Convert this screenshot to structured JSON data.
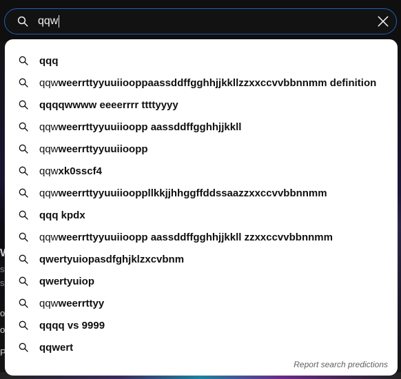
{
  "search": {
    "value": "qqw",
    "icon": "search-icon",
    "clear_icon": "close-icon",
    "accent_color": "#1c62b9"
  },
  "suggestions": [
    {
      "prefix": "",
      "rest": "qqq"
    },
    {
      "prefix": "qqw",
      "rest": "weerrttyyuuiiooppaassddffgghhjjkkllzzxxccvvbbnnmm definition"
    },
    {
      "prefix": "",
      "rest": "qqqqwwww eeeerrrr ttttyyyy"
    },
    {
      "prefix": "qqw",
      "rest": "weerrttyyuuiioopp aassddffgghhjjkkll"
    },
    {
      "prefix": "qqw",
      "rest": "weerrttyyuuiioopp"
    },
    {
      "prefix": "qqw",
      "rest": "xk0sscf4"
    },
    {
      "prefix": "qqw",
      "rest": "weerrttyyuuiiooppllkkjjhhggffddssaazzxxccvvbbnnmm"
    },
    {
      "prefix": "",
      "rest": "qqq kpdx"
    },
    {
      "prefix": "qqw",
      "rest": "weerrttyyuuiioopp aassddffgghhjjkkll zzxxccvvbbnnmm"
    },
    {
      "prefix": "",
      "rest": "qwertyuiopasdfghjklzxcvbnm"
    },
    {
      "prefix": "",
      "rest": "qwertyuiop"
    },
    {
      "prefix": "qqw",
      "rest": "weerrttyy"
    },
    {
      "prefix": "",
      "rest": "qqqq vs 9999"
    },
    {
      "prefix": "",
      "rest": "qqwert"
    }
  ],
  "report_label": "Report search predictions",
  "background_glyphs": [
    "W",
    "s",
    "s",
    "o",
    "o",
    "P"
  ]
}
